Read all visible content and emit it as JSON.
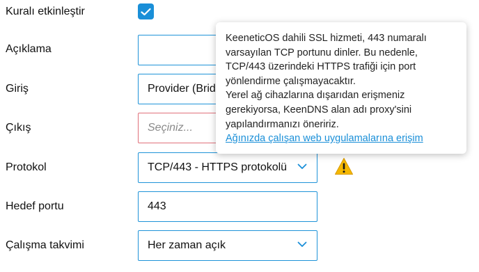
{
  "rule": {
    "enable_label": "Kuralı etkinleştir",
    "enabled": true
  },
  "description": {
    "label": "Açıklama",
    "value": ""
  },
  "input": {
    "label": "Giriş",
    "value": "Provider (Bridge0)"
  },
  "output": {
    "label": "Çıkış",
    "placeholder": "Seçiniz..."
  },
  "protocol": {
    "label": "Protokol",
    "value": "TCP/443 - HTTPS protokolü"
  },
  "target_port": {
    "label": "Hedef portu",
    "value": "443"
  },
  "schedule": {
    "label": "Çalışma takvimi",
    "value": "Her zaman açık"
  },
  "tooltip": {
    "lines": [
      "KeeneticOS dahili SSL hizmeti, 443 numaralı",
      "varsayılan TCP portunu dinler. Bu nedenle,",
      "TCP/443 üzerindeki HTTPS trafiği için port",
      "yönlendirme çalışmayacaktır.",
      "Yerel ağ cihazlarına dışarıdan erişmeniz",
      "gerekiyorsa, KeenDNS alan adı proxy'sini",
      "yapılandırmanızı öneririz."
    ],
    "link": "Ağınızda çalışan web uygulamalarına erişim"
  },
  "icons": {
    "check": "check-icon",
    "chevron": "chevron-down-icon",
    "warning": "warning-icon"
  },
  "colors": {
    "accent": "#1a8fd8",
    "error_border": "#e0707a",
    "warning": "#f5b800"
  }
}
